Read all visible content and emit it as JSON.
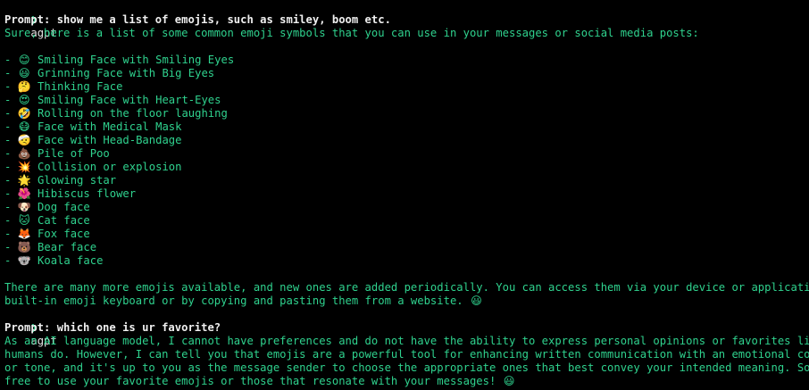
{
  "session1": {
    "shell_prompt": "❯",
    "command": "agpt",
    "prompt_text": "Prompt: show me a list of emojis, such as smiley, boom etc.",
    "intro": "Sure, here is a list of some common emoji symbols that you can use in your messages or social media posts:",
    "items": [
      {
        "bullet": "-",
        "emoji": "😊",
        "label": "Smiling Face with Smiling Eyes"
      },
      {
        "bullet": "-",
        "emoji": "😃",
        "label": "Grinning Face with Big Eyes"
      },
      {
        "bullet": "-",
        "emoji": "🤔",
        "label": "Thinking Face"
      },
      {
        "bullet": "-",
        "emoji": "😍",
        "label": "Smiling Face with Heart-Eyes"
      },
      {
        "bullet": "-",
        "emoji": "🤣",
        "label": "Rolling on the floor laughing"
      },
      {
        "bullet": "-",
        "emoji": "😷",
        "label": "Face with Medical Mask"
      },
      {
        "bullet": "-",
        "emoji": "🤕",
        "label": "Face with Head-Bandage"
      },
      {
        "bullet": "-",
        "emoji": "💩",
        "label": "Pile of Poo"
      },
      {
        "bullet": "-",
        "emoji": "💥",
        "label": "Collision or explosion"
      },
      {
        "bullet": "-",
        "emoji": "🌟",
        "label": "Glowing star"
      },
      {
        "bullet": "-",
        "emoji": "🌺",
        "label": "Hibiscus flower"
      },
      {
        "bullet": "-",
        "emoji": "🐶",
        "label": "Dog face"
      },
      {
        "bullet": "-",
        "emoji": "🐱",
        "label": "Cat face"
      },
      {
        "bullet": "-",
        "emoji": "🦊",
        "label": "Fox face"
      },
      {
        "bullet": "-",
        "emoji": "🐻",
        "label": "Bear face"
      },
      {
        "bullet": "-",
        "emoji": "🐨",
        "label": "Koala face"
      }
    ],
    "outro_line1": "There are many more emojis available, and new ones are added periodically. You can access them via your device or application's",
    "outro_line2": "built-in emoji keyboard or by copying and pasting them from a website.",
    "outro_emoji": "😃"
  },
  "session2": {
    "shell_prompt": "❯",
    "command": "agpt",
    "prompt_text": "Prompt: which one is ur favorite?",
    "answer_line1": "As an AI language model, I cannot have preferences and do not have the ability to express personal opinions or favorites like",
    "answer_line2": "humans do. However, I can tell you that emojis are a powerful tool for enhancing written communication with an emotional context",
    "answer_line3": "or tone, and it's up to you as the message sender to choose the appropriate ones that best convey your intended meaning. So feel",
    "answer_line4": "free to use your favorite emojis or those that resonate with your messages!",
    "answer_emoji": "😃"
  },
  "colors": {
    "background": "#000000",
    "response_text": "#2fd28e",
    "prompt_text": "#f0f0f0"
  }
}
